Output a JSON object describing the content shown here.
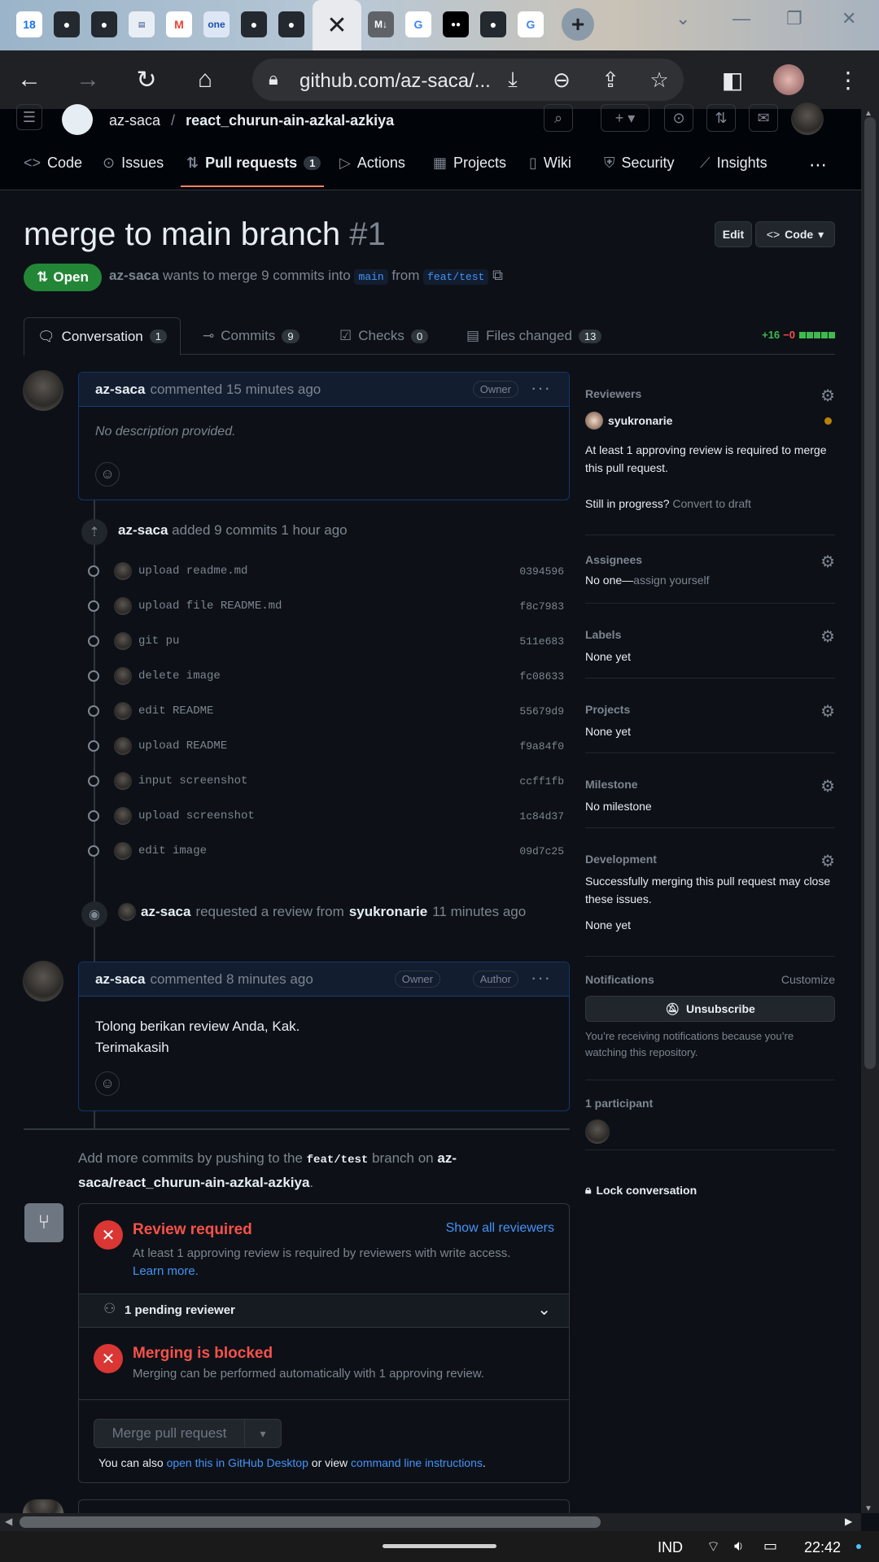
{
  "browser": {
    "tabs": [
      {
        "icon": "calendar-icon",
        "label": "18"
      },
      {
        "icon": "github-icon",
        "label": ""
      },
      {
        "icon": "github-icon",
        "label": ""
      },
      {
        "icon": "site-icon",
        "label": ""
      },
      {
        "icon": "gmail-icon",
        "label": "M"
      },
      {
        "icon": "one-icon",
        "label": "one"
      },
      {
        "icon": "github-icon",
        "label": ""
      },
      {
        "icon": "github-icon",
        "label": ""
      },
      {
        "icon": "close-icon",
        "label": "✕"
      },
      {
        "icon": "markdown-icon",
        "label": "M↓"
      },
      {
        "icon": "google-icon",
        "label": "G"
      },
      {
        "icon": "medium-icon",
        "label": "●●"
      },
      {
        "icon": "github-icon",
        "label": ""
      },
      {
        "icon": "google-icon",
        "label": "G"
      }
    ],
    "url": "github.com/az-saca/..."
  },
  "repo": {
    "owner": "az-saca",
    "separator": "/",
    "name": "react_churun-ain-azkal-azkiya"
  },
  "repo_tabs": [
    {
      "label": "Code",
      "icon": "<>"
    },
    {
      "label": "Issues",
      "icon": "⊙"
    },
    {
      "label": "Pull requests",
      "icon": "⇅",
      "count": "1"
    },
    {
      "label": "Actions",
      "icon": "▷"
    },
    {
      "label": "Projects",
      "icon": "▦"
    },
    {
      "label": "Wiki",
      "icon": "▯"
    },
    {
      "label": "Security",
      "icon": "⛨"
    },
    {
      "label": "Insights",
      "icon": "⟋"
    }
  ],
  "pr": {
    "title": "merge to main branch",
    "number": "#1",
    "edit_label": "Edit",
    "code_label": "Code",
    "state": "Open",
    "author": "az-saca",
    "meta_middle": "wants to merge 9 commits into",
    "base_branch": "main",
    "from_word": "from",
    "head_branch": "feat/test"
  },
  "pr_tabs": [
    {
      "label": "Conversation",
      "count": "1"
    },
    {
      "label": "Commits",
      "count": "9"
    },
    {
      "label": "Checks",
      "count": "0"
    },
    {
      "label": "Files changed",
      "count": "13"
    }
  ],
  "diffstat": {
    "added": "+16",
    "removed": "−0"
  },
  "comment1": {
    "author": "az-saca",
    "when": "commented 15 minutes ago",
    "role": "Owner",
    "body": "No description provided."
  },
  "commits_event": {
    "author": "az-saca",
    "text": "added 9 commits 1 hour ago"
  },
  "commits": [
    {
      "msg": "upload readme.md",
      "sha": "0394596"
    },
    {
      "msg": "upload file README.md",
      "sha": "f8c7983"
    },
    {
      "msg": "git pu",
      "sha": "511e683"
    },
    {
      "msg": "delete image",
      "sha": "fc08633"
    },
    {
      "msg": "edit README",
      "sha": "55679d9"
    },
    {
      "msg": "upload README",
      "sha": "f9a84f0"
    },
    {
      "msg": "input screenshot",
      "sha": "ccff1fb"
    },
    {
      "msg": "upload screenshot",
      "sha": "1c84d37"
    },
    {
      "msg": "edit image",
      "sha": "09d7c25"
    }
  ],
  "review_event": {
    "author": "az-saca",
    "text": "requested a review from",
    "reviewer": "syukronarie",
    "when": "11 minutes ago"
  },
  "comment2": {
    "author": "az-saca",
    "when": "commented 8 minutes ago",
    "role1": "Owner",
    "role2": "Author",
    "line1": "Tolong berikan review Anda, Kak.",
    "line2": "Terimakasih"
  },
  "push_hint": {
    "prefix": "Add more commits by pushing to the",
    "branch": "feat/test",
    "middle": "branch on",
    "repo": "az-saca/react_churun-ain-azkal-azkiya",
    "suffix": "."
  },
  "merge": {
    "review_title": "Review required",
    "review_link": "Show all reviewers",
    "review_desc": "At least 1 approving review is required by reviewers with write access.",
    "learn_more": "Learn more.",
    "pending": "1 pending reviewer",
    "blocked_title": "Merging is blocked",
    "blocked_desc": "Merging can be performed automatically with 1 approving review.",
    "merge_button": "Merge pull request",
    "also_prefix": "You can also",
    "desktop_link": "open this in GitHub Desktop",
    "or_view": "or view",
    "cli_link": "command line instructions",
    "also_suffix": "."
  },
  "sidebar": {
    "reviewers_title": "Reviewers",
    "reviewer_name": "syukronarie",
    "reviewers_note": "At least 1 approving review is required to merge this pull request.",
    "still_progress": "Still in progress?",
    "convert_draft": "Convert to draft",
    "assignees_title": "Assignees",
    "assignees_none": "No one—",
    "assign_yourself": "assign yourself",
    "labels_title": "Labels",
    "labels_value": "None yet",
    "projects_title": "Projects",
    "projects_value": "None yet",
    "milestone_title": "Milestone",
    "milestone_value": "No milestone",
    "development_title": "Development",
    "development_note": "Successfully merging this pull request may close these issues.",
    "development_value": "None yet",
    "notifications_title": "Notifications",
    "customize": "Customize",
    "unsubscribe": "Unsubscribe",
    "notify_note": "You’re receiving notifications because you’re watching this repository.",
    "participants": "1 participant",
    "lock": "Lock conversation"
  },
  "taskbar": {
    "lang": "IND",
    "time": "22:42"
  },
  "colors": {
    "accent_green": "#238636",
    "danger": "#da3633",
    "link": "#4493f8",
    "tab_underline": "#f78166"
  }
}
